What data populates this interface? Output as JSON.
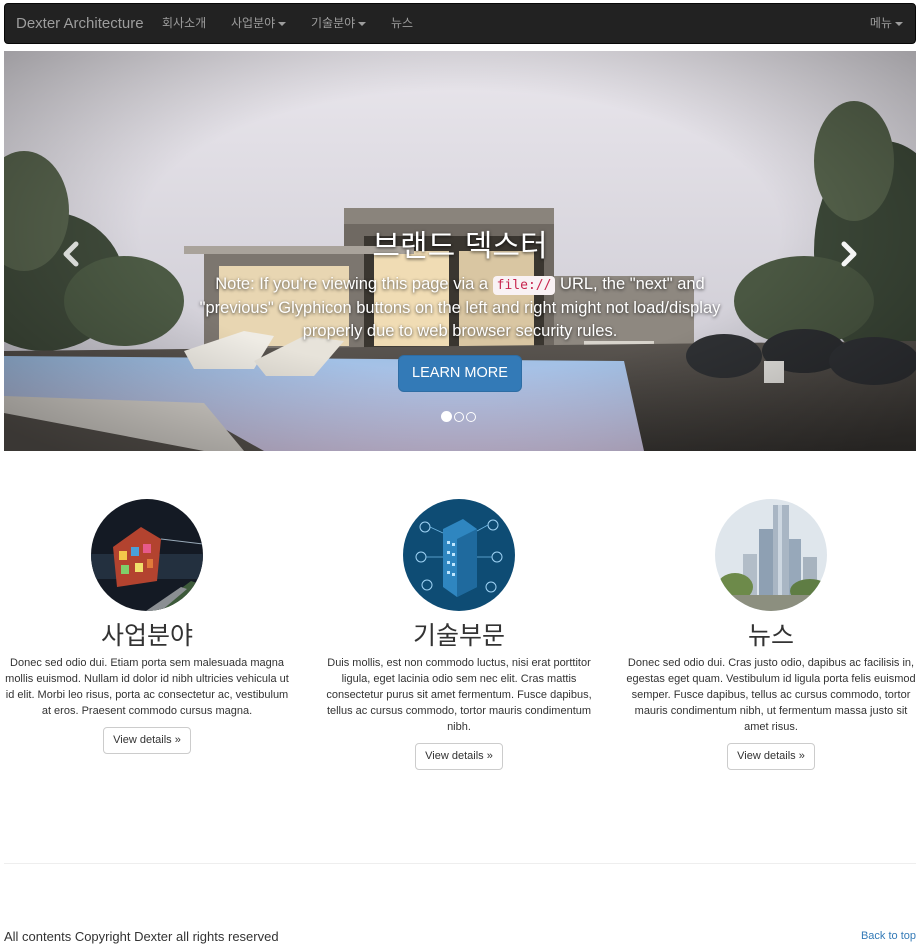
{
  "navbar": {
    "brand": "Dexter Architecture",
    "items": [
      {
        "label": "회사소개"
      },
      {
        "label": "사업분야"
      },
      {
        "label": "기술분야"
      },
      {
        "label": "뉴스"
      }
    ],
    "right_menu": "메뉴"
  },
  "carousel": {
    "title": "브랜드 덱스터",
    "note_before": "Note: If you're viewing this page via a ",
    "note_code": "file://",
    "note_after": " URL, the \"next\" and \"previous\" Glyphicon buttons on the left and right might not load/display properly due to web browser security rules.",
    "button": "LEARN MORE",
    "slide_count": 3,
    "active_slide": 1
  },
  "features": [
    {
      "title": "사업분야",
      "text": "Donec sed odio dui. Etiam porta sem malesuada magna mollis euismod. Nullam id dolor id nibh ultricies vehicula ut id elit. Morbi leo risus, porta ac consectetur ac, vestibulum at eros. Praesent commodo cursus magna.",
      "button": "View details »"
    },
    {
      "title": "기술부문",
      "text": "Duis mollis, est non commodo luctus, nisi erat porttitor ligula, eget lacinia odio sem nec elit. Cras mattis consectetur purus sit amet fermentum. Fusce dapibus, tellus ac cursus commodo, tortor mauris condimentum nibh.",
      "button": "View details »"
    },
    {
      "title": "뉴스",
      "text": "Donec sed odio dui. Cras justo odio, dapibus ac facilisis in, egestas eget quam. Vestibulum id ligula porta felis euismod semper. Fusce dapibus, tellus ac cursus commodo, tortor mauris condimentum nibh, ut fermentum massa justo sit amet risus.",
      "button": "View details »"
    }
  ],
  "footer": {
    "copyright": "All contents Copyright Dexter all rights reserved",
    "back_to_top": "Back to top"
  },
  "colors": {
    "navbar_bg": "#222222",
    "navbar_text": "#9d9d9d",
    "primary": "#337ab7",
    "link": "#337ab7"
  },
  "icons": {
    "prev": "chevron-left-icon",
    "next": "chevron-right-icon",
    "dropdown": "caret-down-icon"
  }
}
